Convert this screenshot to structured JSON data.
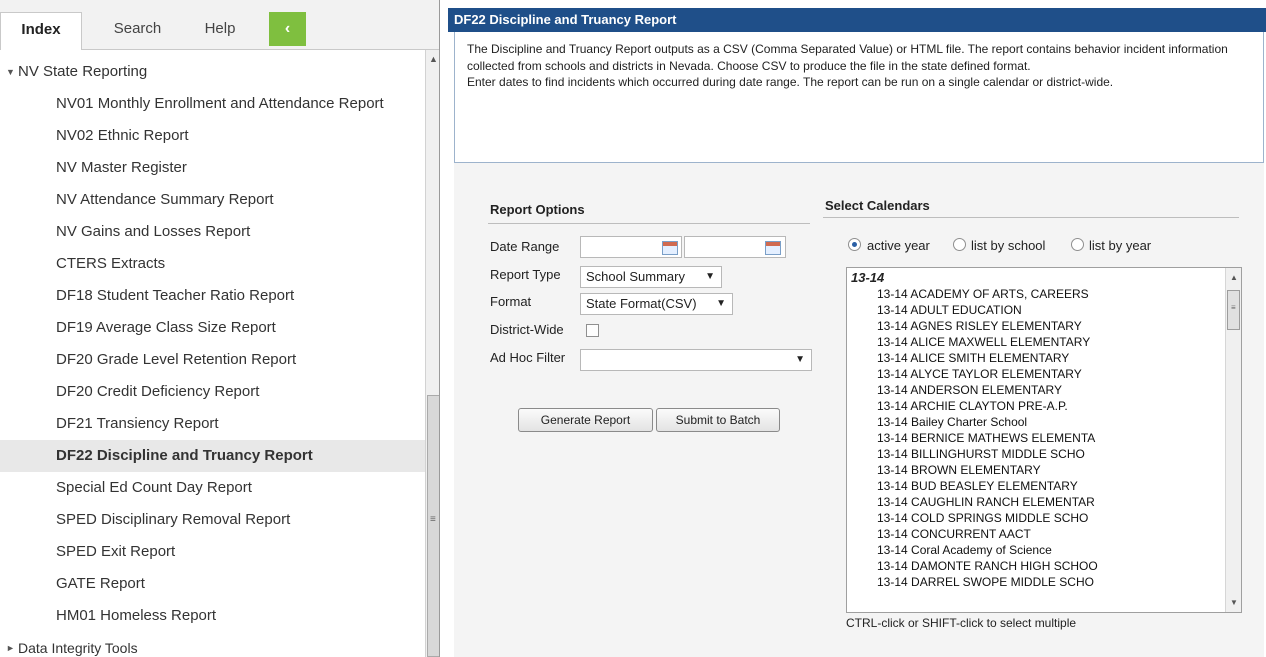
{
  "tabs": {
    "index": "Index",
    "search": "Search",
    "help": "Help",
    "collapse": "‹"
  },
  "tree": {
    "folder_open": "NV State Reporting",
    "items": [
      "NV01 Monthly Enrollment and Attendance Report",
      "NV02 Ethnic Report",
      "NV Master Register",
      "NV Attendance Summary Report",
      "NV Gains and Losses Report",
      "CTERS Extracts",
      "DF18 Student Teacher Ratio Report",
      "DF19 Average Class Size Report",
      "DF20 Grade Level Retention Report",
      "DF20 Credit Deficiency Report",
      "DF21 Transiency Report",
      "DF22 Discipline and Truancy Report",
      "Special Ed Count Day Report",
      "SPED Disciplinary Removal Report",
      "SPED Exit Report",
      "GATE Report",
      "HM01 Homeless Report"
    ],
    "folder_closed": "Data Integrity Tools"
  },
  "report": {
    "title": "DF22 Discipline and Truancy Report",
    "desc_1": "The Discipline and Truancy Report outputs as a CSV (Comma Separated Value) or HTML file. The report contains behavior incident information collected from schools and districts in Nevada. Choose CSV to produce the file in the state defined format.",
    "desc_2": "Enter dates to find incidents which occurred during date range. The report can be run on a single calendar or district-wide."
  },
  "options": {
    "section_title": "Report Options",
    "date_range_label": "Date Range",
    "report_type_label": "Report Type",
    "report_type_value": "School Summary",
    "format_label": "Format",
    "format_value": "State Format(CSV)",
    "district_wide_label": "District-Wide",
    "ad_hoc_label": "Ad Hoc Filter",
    "ad_hoc_value": "",
    "generate_label": "Generate Report",
    "batch_label": "Submit to Batch"
  },
  "calendars": {
    "section_title": "Select Calendars",
    "radio_active": "active year",
    "radio_school": "list by school",
    "radio_year": "list by year",
    "group": "13-14",
    "items": [
      "13-14 ACADEMY OF ARTS, CAREERS",
      "13-14 ADULT EDUCATION",
      "13-14 AGNES RISLEY ELEMENTARY",
      "13-14 ALICE MAXWELL ELEMENTARY",
      "13-14 ALICE SMITH ELEMENTARY",
      "13-14 ALYCE TAYLOR ELEMENTARY",
      "13-14 ANDERSON ELEMENTARY",
      "13-14 ARCHIE CLAYTON PRE-A.P.",
      "13-14 Bailey Charter School",
      "13-14 BERNICE MATHEWS ELEMENTA",
      "13-14 BILLINGHURST MIDDLE SCHO",
      "13-14 BROWN ELEMENTARY",
      "13-14 BUD BEASLEY ELEMENTARY",
      "13-14 CAUGHLIN RANCH ELEMENTAR",
      "13-14 COLD SPRINGS MIDDLE SCHO",
      "13-14 CONCURRENT AACT",
      "13-14 Coral Academy of Science",
      "13-14 DAMONTE RANCH HIGH SCHOO",
      "13-14 DARREL SWOPE MIDDLE SCHO"
    ],
    "hint": "CTRL-click or SHIFT-click to select multiple"
  }
}
